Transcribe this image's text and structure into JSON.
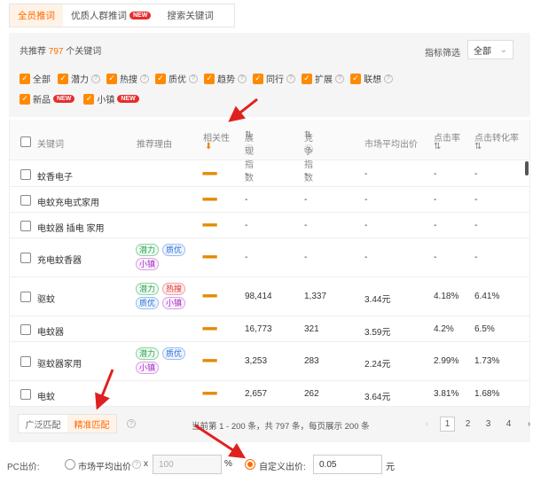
{
  "tabs": [
    {
      "label": "全员推词"
    },
    {
      "label": "优质人群推词",
      "badge": "NEW"
    },
    {
      "label": "搜索关键词"
    }
  ],
  "filter": {
    "count_prefix": "共推荐",
    "count": "797",
    "count_suffix": "个关键词",
    "select_label": "指标筛选",
    "select_value": "全部",
    "checks_row1": [
      "全部",
      "潜力",
      "热搜",
      "质优",
      "趋势",
      "同行",
      "扩展",
      "联想"
    ],
    "checks_row2": [
      {
        "label": "新品",
        "badge": "NEW"
      },
      {
        "label": "小镇",
        "badge": "NEW"
      }
    ]
  },
  "table": {
    "headers": {
      "keyword": "关键词",
      "reason": "推荐理由",
      "relevance": "相关性",
      "impressions": "展现指数",
      "competition": "竞争指数",
      "avg_bid": "市场平均出价",
      "ctr": "点击率",
      "cvr": "点击转化率"
    },
    "rows": [
      {
        "kw": "蚊香电子",
        "imp": "-",
        "comp": "-",
        "bid": "-",
        "ctr": "-",
        "cvr": "-",
        "tags": []
      },
      {
        "kw": "电蚊充电式家用",
        "imp": "-",
        "comp": "-",
        "bid": "-",
        "ctr": "-",
        "cvr": "-",
        "tags": []
      },
      {
        "kw": "电蚊器 插电 家用",
        "imp": "-",
        "comp": "-",
        "bid": "-",
        "ctr": "-",
        "cvr": "-",
        "tags": []
      },
      {
        "kw": "充电蚊香器",
        "imp": "-",
        "comp": "-",
        "bid": "-",
        "ctr": "-",
        "cvr": "-",
        "tags": [
          "潜力",
          "质优",
          "小镇"
        ]
      },
      {
        "kw": "驱蚊",
        "imp": "98,414",
        "comp": "1,337",
        "bid": "3.44元",
        "ctr": "4.18%",
        "cvr": "6.41%",
        "tags": [
          "潜力",
          "热搜",
          "质优",
          "小镇"
        ]
      },
      {
        "kw": "电蚊器",
        "imp": "16,773",
        "comp": "321",
        "bid": "3.59元",
        "ctr": "4.2%",
        "cvr": "6.5%",
        "tags": []
      },
      {
        "kw": "驱蚊器家用",
        "imp": "3,253",
        "comp": "283",
        "bid": "2.24元",
        "ctr": "2.99%",
        "cvr": "1.73%",
        "tags": [
          "潜力",
          "质优",
          "小镇"
        ]
      },
      {
        "kw": "电蚊",
        "imp": "2,657",
        "comp": "262",
        "bid": "3.64元",
        "ctr": "3.81%",
        "cvr": "1.68%",
        "tags": []
      }
    ]
  },
  "footer": {
    "match_broad": "广泛匹配",
    "match_exact": "精准匹配",
    "page_info": "当前第 1 - 200 条，共 797 条，每页展示 200 条",
    "pages": [
      "1",
      "2",
      "3",
      "4"
    ],
    "prev": "‹",
    "next": "›"
  },
  "pc": {
    "label": "PC出价:",
    "market_label": "市场平均出价",
    "times": "x",
    "market_placeholder": "100",
    "percent": "%",
    "custom_label": "自定义出价:",
    "custom_value": "0.05",
    "unit": "元"
  }
}
